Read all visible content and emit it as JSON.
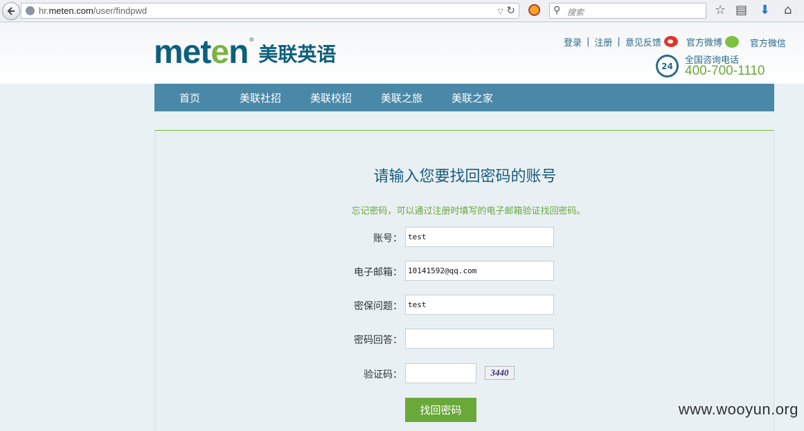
{
  "browser": {
    "url_prefix": "hr.",
    "url_domain": "meten.com",
    "url_path": "/user/findpwd",
    "search_placeholder": "搜索"
  },
  "header": {
    "logo_en_1": "met",
    "logo_en_2": "e",
    "logo_en_3": "n",
    "logo_reg": "®",
    "logo_cn": "美联英语",
    "links": {
      "login": "登录",
      "register": "注册",
      "feedback": "意见反馈",
      "weibo": "官方微博",
      "wechat": "官方微信"
    },
    "phone_label": "全国咨询电话",
    "phone_badge": "24",
    "phone_number": "400-700-1110"
  },
  "nav": {
    "items": [
      "首页",
      "美联社招",
      "美联校招",
      "美联之旅",
      "美联之家"
    ]
  },
  "form": {
    "title": "请输入您要找回密码的账号",
    "subtitle": "忘记密码，可以通过注册时填写的电子邮箱验证找回密码。",
    "account_label": "账号：",
    "account_value": "test",
    "email_label": "电子邮箱：",
    "email_value": "10141592@qq.com",
    "question_label": "密保问题：",
    "question_value": "test",
    "answer_label": "密码回答：",
    "answer_value": "",
    "captcha_label": "验证码：",
    "captcha_value": "",
    "captcha_image_text": "3440",
    "submit_label": "找回密码"
  },
  "watermark": "www.wooyun.org",
  "colors": {
    "brand_blue": "#0c5f7e",
    "brand_green": "#6aa83a",
    "nav_bg": "#4a88a8"
  }
}
